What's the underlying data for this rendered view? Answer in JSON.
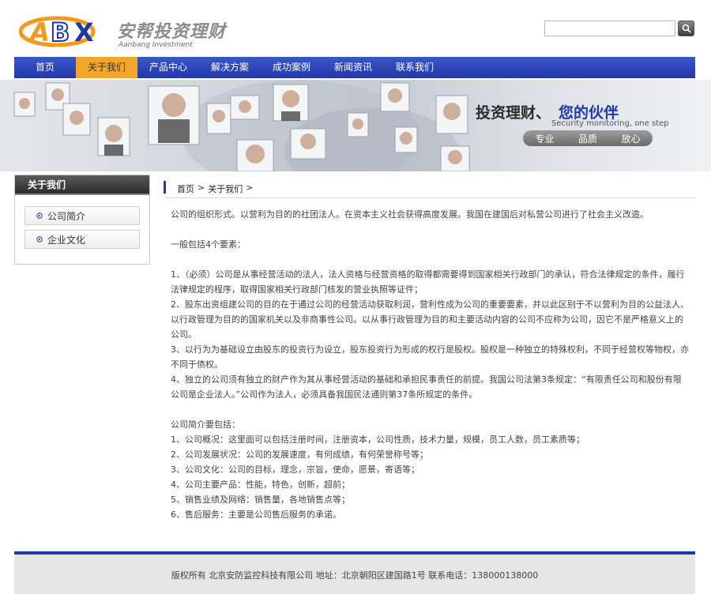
{
  "header": {
    "logo_mark": "ABX",
    "logo_cn": "安帮投资理财",
    "logo_en": "Aanbang Investment",
    "search_value": "",
    "search_placeholder": ""
  },
  "nav": {
    "items": [
      "首页",
      "关于我们",
      "产品中心",
      "解决方案",
      "成功案例",
      "新闻资讯",
      "联系我们"
    ],
    "active_index": 1
  },
  "banner": {
    "slogan_a": "投资理财、",
    "slogan_b": "您的伙伴",
    "subtitle": "Security monitoring, one step",
    "tags": [
      "专业",
      "品质",
      "放心"
    ]
  },
  "sidebar": {
    "title": "关于我们",
    "items": [
      "公司简介",
      "企业文化"
    ]
  },
  "breadcrumb": {
    "home": "首页",
    "sep": ">",
    "current": "关于我们"
  },
  "article": {
    "lines": [
      "公司的组织形式。以营利为目的的社团法人。在资本主义社会获得高度发展。我国在建国后对私营公司进行了社会主义改造。",
      "",
      "一般包括4个要素：",
      "",
      "1、（必须）公司是从事经营活动的法人，法人资格与经营资格的取得都需要得到国家相关行政部门的承认，符合法律规定的条件，履行法律规定的程序，取得国家相关行政部门核发的营业执照等证件；",
      "2、股东出资组建公司的目的在于通过公司的经营活动获取利润，营利性成为公司的重要要素，并以此区别于不以营利为目的公益法人、以行政管理为目的的国家机关以及非商事性公司。以从事行政管理为目的和主要活动内容的公司不应称为公司，因它不是严格意义上的公司。",
      "3、以行为为基础设立由股东的投资行为设立，股东投资行为形成的权行是股权。股权是一种独立的特殊权利，不同于经营权等物权，亦不同于债权。",
      "4、独立的公司须有独立的财产作为其从事经营活动的基础和承担民事责任的前提。我国公司法第3条规定：“有限责任公司和股份有限公司是企业法人。”公司作为法人，必须具备我国民法通则第37条所规定的条件。",
      "",
      "公司简介要包括：",
      "1、公司概况：这里面可以包括注册时间，注册资本，公司性质，技术力量，规模，员工人数，员工素质等；",
      "2、公司发展状况：公司的发展速度，有何成绩，有何荣誉称号等；",
      "3、公司文化：公司的目标，理念，宗旨，使命，愿景，寄语等；",
      "4、公司主要产品：性能，特色，创新，超前；",
      "5、销售业绩及网络：销售量，各地销售点等；",
      "6、售后服务：主要是公司售后服务的承诺。"
    ]
  },
  "footer": {
    "text": "版权所有 北京安防监控科技有限公司 地址：北京朝阳区建国路1号 联系电话：138000138000"
  },
  "colors": {
    "nav_blue": "#2138a8",
    "nav_active": "#f4a62a",
    "logo_orange": "#f29a1d",
    "logo_blue": "#1f3aa8"
  }
}
